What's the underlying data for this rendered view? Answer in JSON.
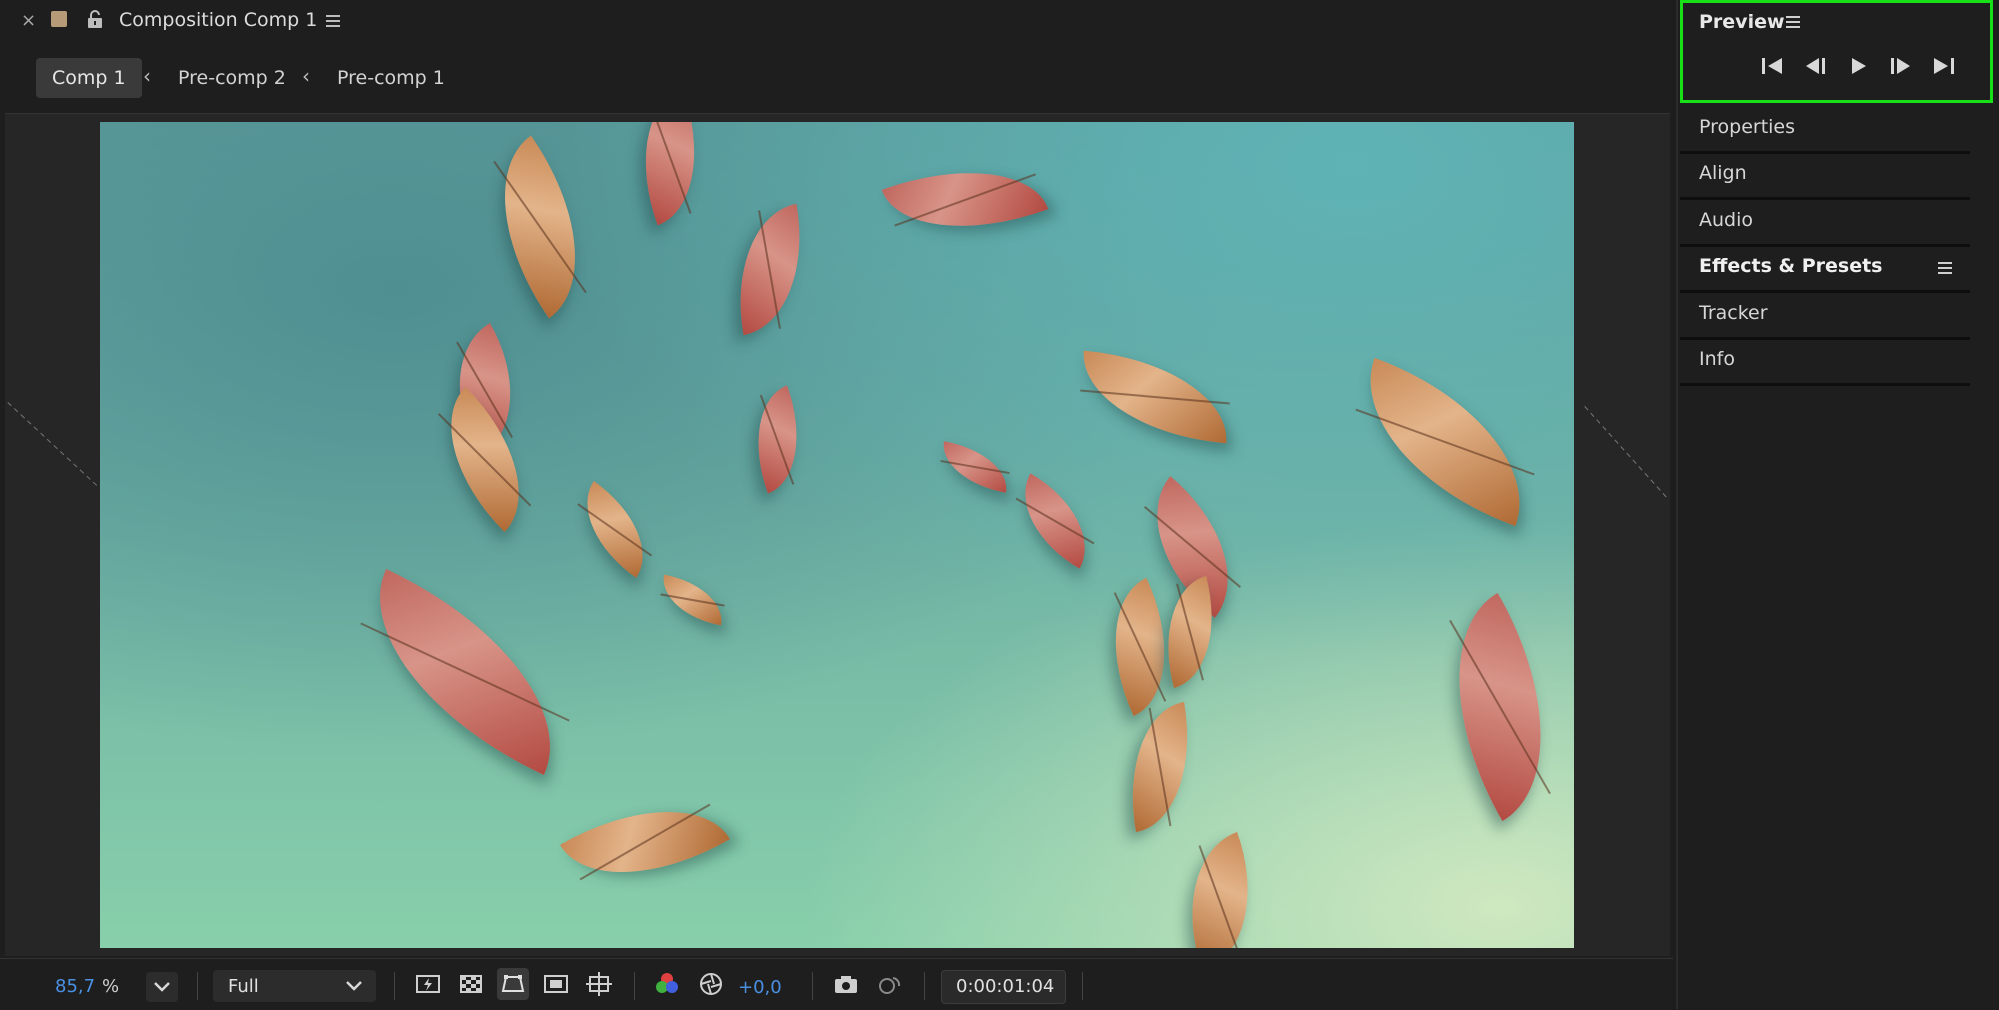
{
  "composition_panel": {
    "close_glyph": "×",
    "title": "Composition Comp 1",
    "breadcrumb": [
      "Comp 1",
      "Pre-comp 2",
      "Pre-comp 1"
    ],
    "toolbar": {
      "zoom_value": "85,7",
      "zoom_unit": "%",
      "resolution": "Full",
      "exposure": "+0,0",
      "timecode": "0:00:01:04"
    }
  },
  "preview_panel": {
    "title": "Preview",
    "controls": [
      "first-frame-icon",
      "previous-frame-icon",
      "play-icon",
      "next-frame-icon",
      "last-frame-icon"
    ]
  },
  "side_panels": [
    "Properties",
    "Align",
    "Audio",
    "Effects & Presets",
    "Tracker",
    "Info"
  ],
  "colors": {
    "highlight": "#18e018",
    "accent_blue": "#4a90e2",
    "comp_label": "#b79b78"
  }
}
